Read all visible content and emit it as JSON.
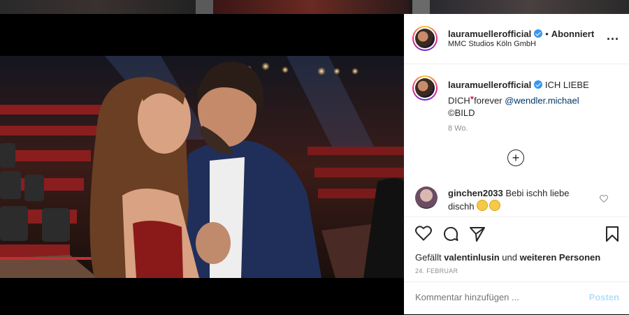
{
  "post": {
    "username": "lauramuellerofficial",
    "follow_status": "Abonniert",
    "separator": "•",
    "location": "MMC Studios Köln GmbH",
    "more": "..."
  },
  "caption": {
    "username": "lauramuellerofficial",
    "text_part1": " ICH LIEBE DICH",
    "text_part2": "forever ",
    "mention": "@wendler.michael",
    "text_part3": "©BILD",
    "time_ago": "8 Wo."
  },
  "comment": {
    "username": "ginchen2033",
    "text": " Bebi ischh liebe dischh"
  },
  "actions": {
    "liked_by_prefix": "Gefällt ",
    "liked_by_user": "valentinlusin",
    "liked_by_middle": " und ",
    "liked_by_rest": "weiteren Personen",
    "date": "24. FEBRUAR"
  },
  "comment_input": {
    "placeholder": "Kommentar hinzufügen ...",
    "post_label": "Posten"
  },
  "icons": [
    "verified-icon",
    "more-icon",
    "add-icon",
    "heart-icon",
    "comment-icon",
    "share-icon",
    "bookmark-icon",
    "user-tag-icon"
  ],
  "colors": {
    "link": "#00376b",
    "verified": "#3897f0",
    "post_button": "#b2dffc"
  }
}
